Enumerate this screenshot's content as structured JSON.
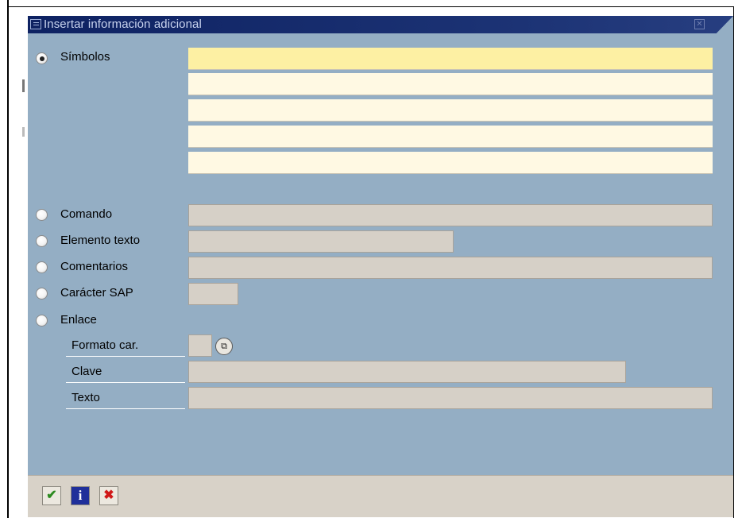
{
  "dialog": {
    "title": "Insertar información adicional",
    "close_icon": "close-icon"
  },
  "options": {
    "simbolos": "Símbolos",
    "comando": "Comando",
    "elemento_texto": "Elemento texto",
    "comentarios": "Comentarios",
    "caracter_sap": "Carácter SAP",
    "enlace": "Enlace"
  },
  "selected_option": "Símbolos",
  "enlace_fields": {
    "formato_car": "Formato car.",
    "clave": "Clave",
    "texto": "Texto"
  },
  "fields": {
    "simbolos_lines": [
      "",
      "",
      "",
      "",
      ""
    ],
    "comando": "",
    "elemento_texto": "",
    "comentarios": "",
    "caracter_sap": "",
    "formato_car": "",
    "clave": "",
    "texto": ""
  },
  "toolbar": {
    "ok_icon": "checkmark-icon",
    "info_icon": "info-icon",
    "cancel_icon": "cancel-x-icon",
    "info_glyph": "i",
    "cancel_glyph": "✖",
    "ok_glyph": "✔",
    "f4_glyph": "⧉"
  },
  "colors": {
    "titlebar": "#11266a",
    "dialog_bg": "#94aec4",
    "active_field": "#fdf0a3",
    "input_field": "#fff9e3",
    "disabled_field": "#d6d0c7",
    "footer": "#d8d2c8"
  }
}
